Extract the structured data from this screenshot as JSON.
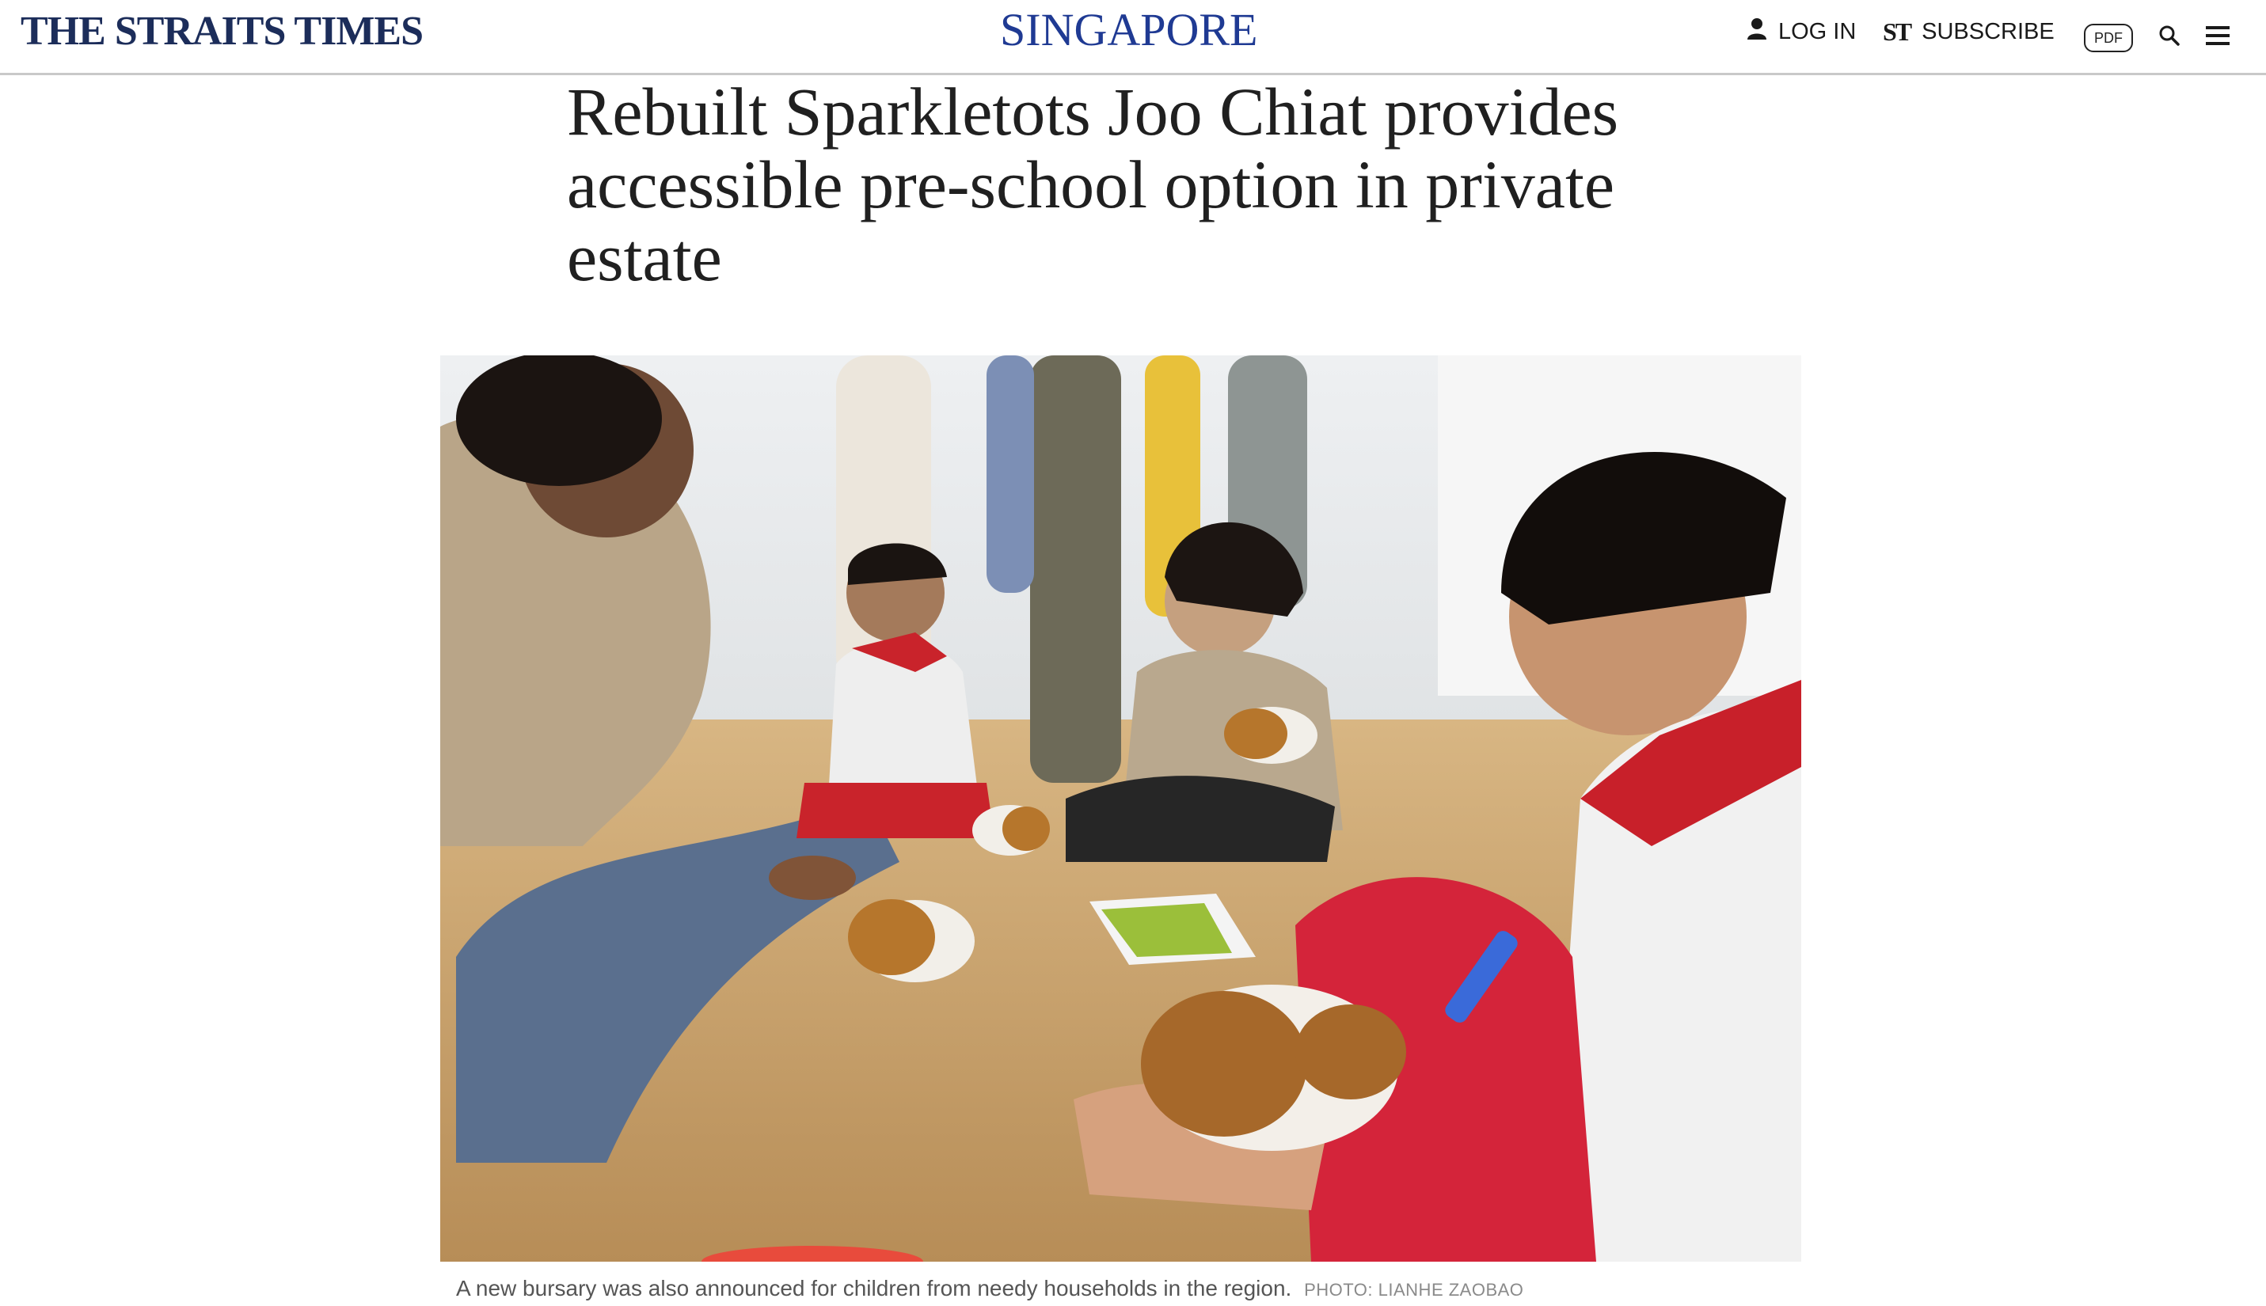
{
  "header": {
    "brand": "THE STRAITS TIMES",
    "section": "SINGAPORE",
    "login_label": "LOG IN",
    "subscribe_mark": "ST",
    "subscribe_label": "SUBSCRIBE",
    "pdf_label": "PDF",
    "icons": {
      "login": "user-icon",
      "search": "search-icon",
      "menu": "hamburger-menu-icon"
    }
  },
  "article": {
    "headline": "Rebuilt Sparkletots Joo Chiat provides accessible pre-school option in private estate",
    "photo_alt": "Children and teachers playing with toy guinea pigs on a wooden floor",
    "caption": "A new bursary was also announced for children from needy households in the region.",
    "credit": "PHOTO: LIANHE ZAOBAO"
  },
  "colors": {
    "brand": "#1c2d5a",
    "section": "#1f3a93",
    "divider": "#c9c9c9"
  }
}
